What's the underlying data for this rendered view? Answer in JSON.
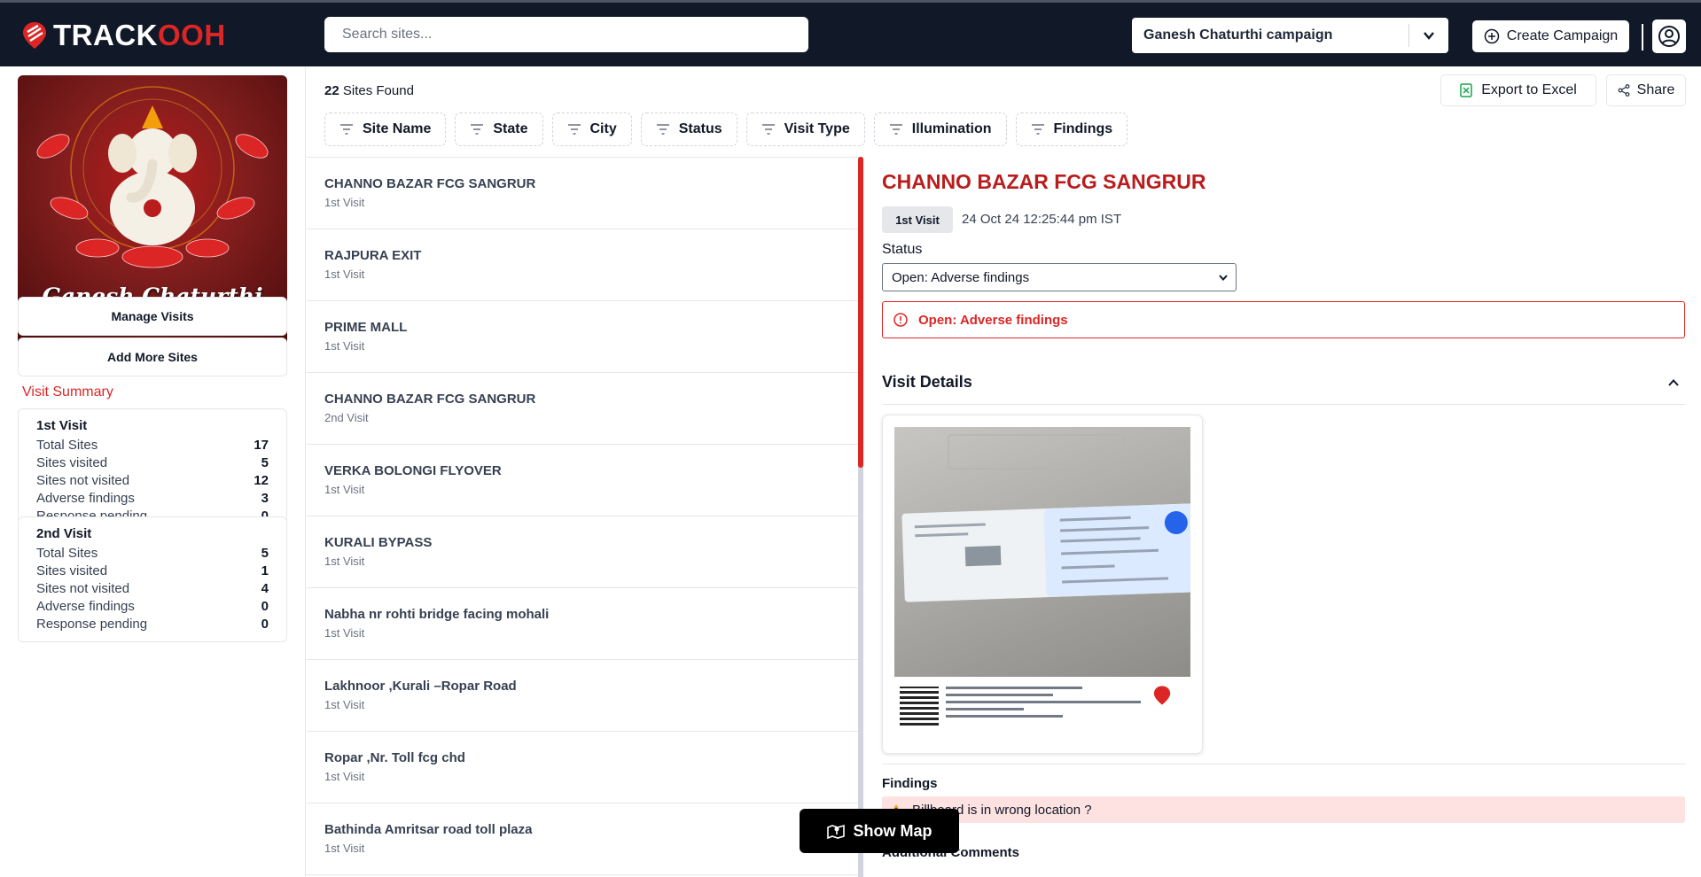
{
  "header": {
    "logo_main": "TRACK",
    "logo_accent": "OOH",
    "search_placeholder": "Search sites...",
    "campaign": "Ganesh Chaturthi campaign",
    "create_label": "Create Campaign"
  },
  "sidebar": {
    "poster_title": "Ganesh Chaturthi",
    "manage_label": "Manage Visits",
    "add_label": "Add More Sites",
    "summary_title": "Visit Summary",
    "cards": [
      {
        "title": "1st Visit",
        "rows": [
          {
            "label": "Total Sites",
            "value": "17"
          },
          {
            "label": "Sites visited",
            "value": "5"
          },
          {
            "label": "Sites not visited",
            "value": "12"
          },
          {
            "label": "Adverse findings",
            "value": "3"
          },
          {
            "label": "Response pending",
            "value": "0"
          }
        ]
      },
      {
        "title": "2nd Visit",
        "rows": [
          {
            "label": "Total Sites",
            "value": "5"
          },
          {
            "label": "Sites visited",
            "value": "1"
          },
          {
            "label": "Sites not visited",
            "value": "4"
          },
          {
            "label": "Adverse findings",
            "value": "0"
          },
          {
            "label": "Response pending",
            "value": "0"
          }
        ]
      }
    ]
  },
  "toolbar": {
    "found_count": "22",
    "found_suffix": "Sites Found",
    "filters": [
      "Site Name",
      "State",
      "City",
      "Status",
      "Visit Type",
      "Illumination",
      "Findings"
    ],
    "export_label": "Export to Excel",
    "share_label": "Share"
  },
  "sites": [
    {
      "name": "CHANNO BAZAR FCG SANGRUR",
      "visit": "1st Visit"
    },
    {
      "name": "RAJPURA EXIT",
      "visit": "1st Visit"
    },
    {
      "name": "PRIME MALL",
      "visit": "1st Visit"
    },
    {
      "name": "CHANNO BAZAR FCG SANGRUR",
      "visit": "2nd Visit"
    },
    {
      "name": "VERKA BOLONGI FLYOVER",
      "visit": "1st Visit"
    },
    {
      "name": "KURALI BYPASS",
      "visit": "1st Visit"
    },
    {
      "name": "Nabha nr rohti bridge facing mohali",
      "visit": "1st Visit"
    },
    {
      "name": "Lakhnoor ,Kurali –Ropar Road",
      "visit": "1st Visit"
    },
    {
      "name": "Ropar ,Nr. Toll fcg chd",
      "visit": "1st Visit"
    },
    {
      "name": "Bathinda Amritsar road toll plaza",
      "visit": "1st Visit"
    }
  ],
  "show_map_label": "Show Map",
  "detail": {
    "title": "CHANNO BAZAR FCG SANGRUR",
    "visit_badge": "1st Visit",
    "timestamp": "24 Oct 24 12:25:44 pm IST",
    "status_label": "Status",
    "status_value": "Open: Adverse findings",
    "alert_text": "Open: Adverse findings",
    "visit_details_label": "Visit Details",
    "findings_label": "Findings",
    "finding_text": "Billboard is in wrong location ?",
    "comments_label": "Additional Comments"
  },
  "colors": {
    "brand_red": "#dc2626",
    "header_bg": "#111827",
    "title_red": "#b91c1c",
    "finding_bg": "#fee2e2"
  }
}
